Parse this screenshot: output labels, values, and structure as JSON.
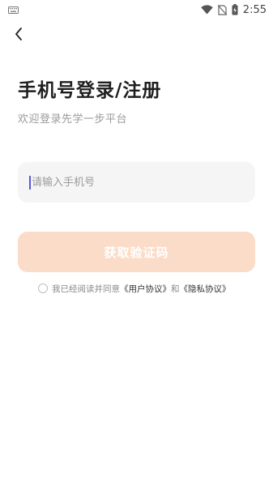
{
  "status_bar": {
    "time": "2:55",
    "icons": [
      "keyboard-icon",
      "wifi-icon",
      "no-sim-icon",
      "battery-charging-icon"
    ]
  },
  "header": {
    "back_icon": "chevron-left-icon",
    "title": "手机号登录/注册",
    "subtitle": "欢迎登录先学一步平台"
  },
  "form": {
    "phone_placeholder": "请输入手机号",
    "phone_value": "",
    "get_code_label": "获取验证码"
  },
  "agreement": {
    "prefix": "我已经阅读并同意",
    "user_agreement": "《用户协议》",
    "conjunction": "和",
    "privacy_policy": "《隐私协议》",
    "checked": false
  },
  "colors": {
    "button_disabled_bg": "#fbdcc8",
    "input_bg": "#f5f5f5",
    "caret": "#5a5ad6"
  }
}
